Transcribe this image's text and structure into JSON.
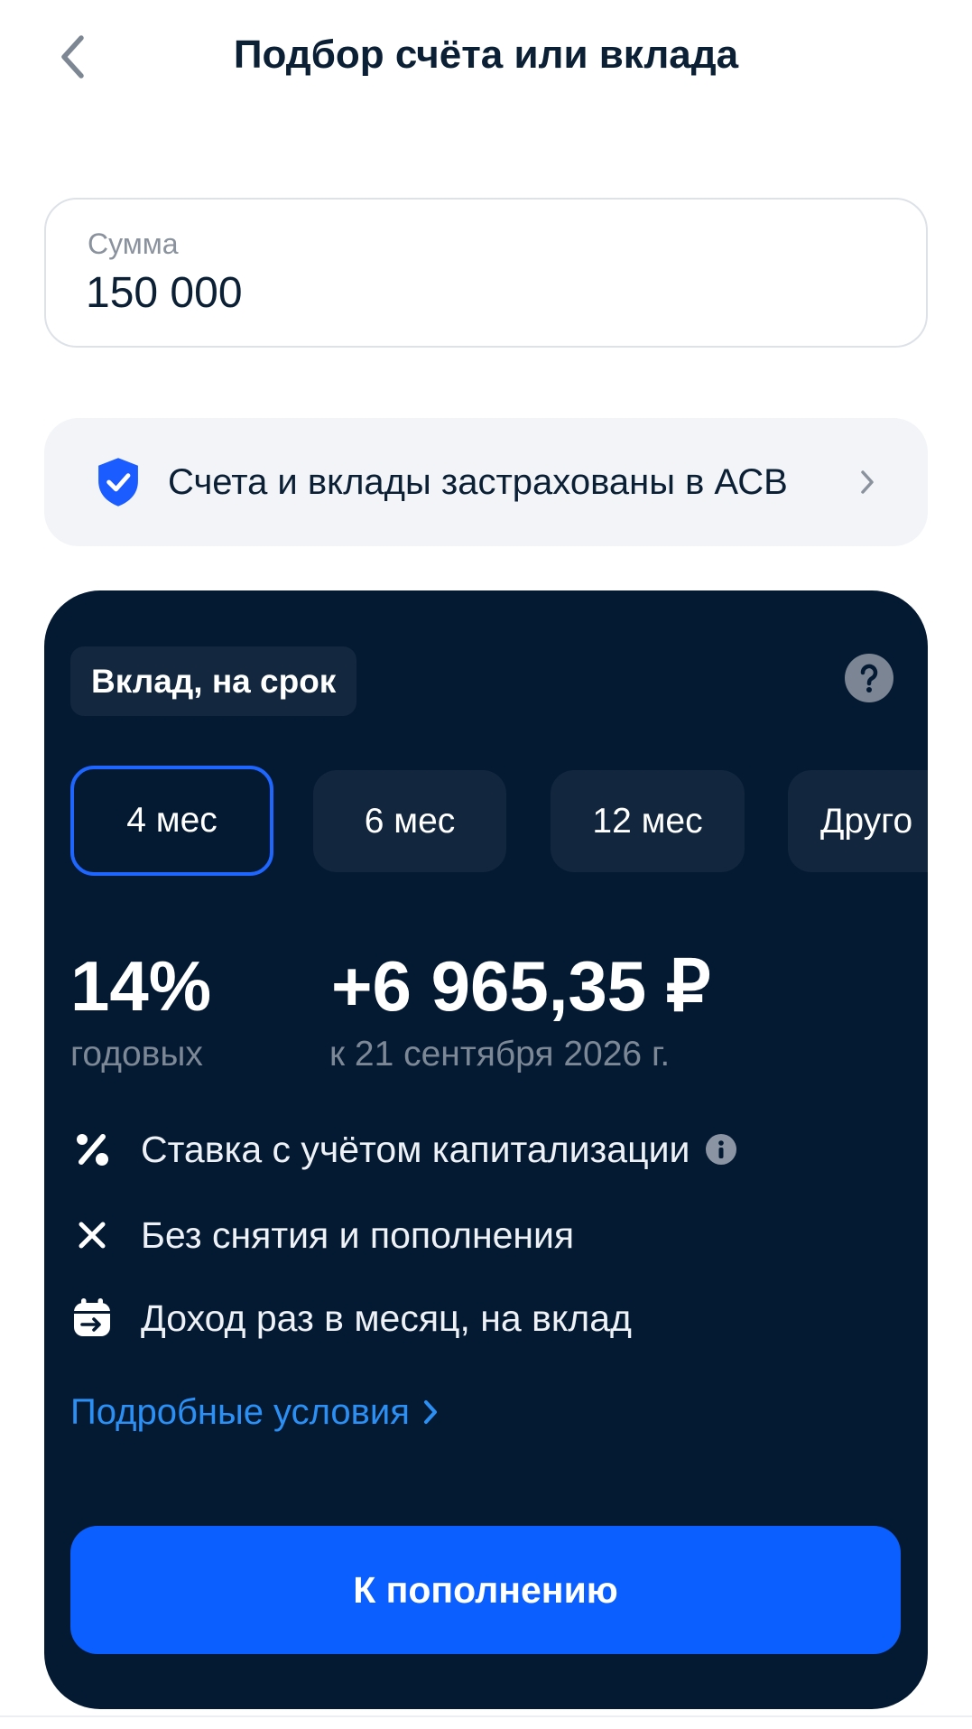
{
  "header": {
    "title": "Подбор счёта или вклада",
    "back_icon": "chevron-left-icon"
  },
  "amount": {
    "label": "Сумма",
    "value": "150 000"
  },
  "insurance": {
    "icon": "shield-check-icon",
    "text": "Счета и вклады застрахованы в АСВ",
    "arrow_icon": "chevron-right-icon"
  },
  "deposit": {
    "badge": "Вклад, на срок",
    "help_icon": "question-icon",
    "terms": [
      {
        "label": "4 мес",
        "selected": true
      },
      {
        "label": "6 мес",
        "selected": false
      },
      {
        "label": "12 мес",
        "selected": false
      },
      {
        "label": "Друго",
        "selected": false
      }
    ],
    "rate": {
      "value": "14%",
      "caption": "годовых"
    },
    "income": {
      "value": "+6 965,35 ₽",
      "caption": "к 21 сентября 2026 г."
    },
    "features": [
      {
        "icon": "percent-icon",
        "text": "Ставка с учётом капитализации",
        "info_icon": "info-icon"
      },
      {
        "icon": "close-icon",
        "text": "Без снятия и пополнения"
      },
      {
        "icon": "calendar-arrow-icon",
        "text": "Доход раз в месяц, на вклад"
      }
    ],
    "details_link": "Подробные условия",
    "cta": "К пополнению"
  },
  "colors": {
    "accent": "#0b5fff",
    "card": "#041a33",
    "link": "#2b8ff4",
    "shield": "#1a5cff",
    "selected_border": "#1f66ff"
  }
}
